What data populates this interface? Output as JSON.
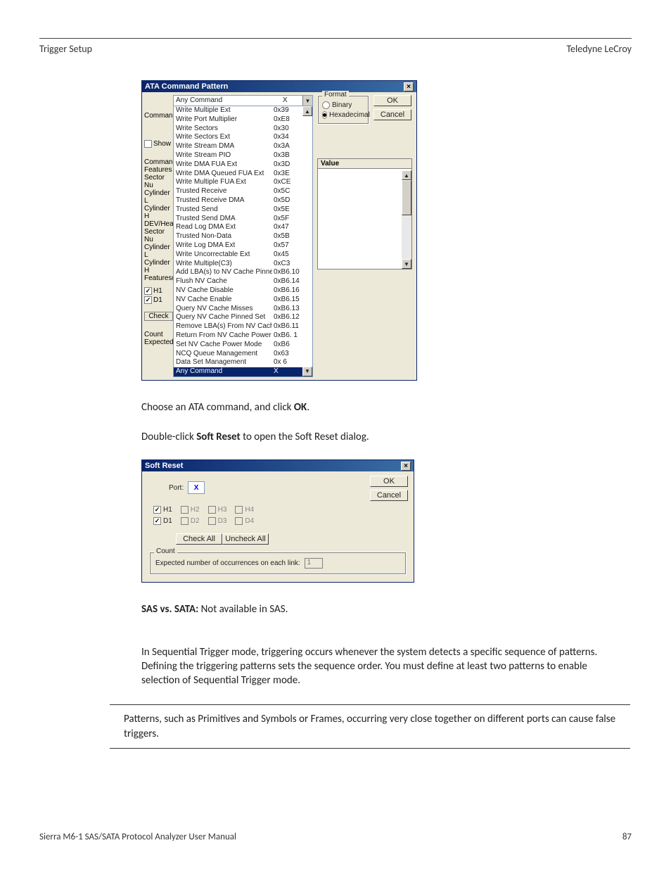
{
  "header": {
    "left": "Trigger Setup",
    "right": "Teledyne LeCroy"
  },
  "ata": {
    "title": "ATA Command Pattern",
    "command_label": "Command:",
    "combo": {
      "text": "Any Command",
      "code": "X"
    },
    "left_labels": [
      "Show",
      "Command",
      "Features",
      "Sector Nu",
      "Cylinder L",
      "Cylinder H",
      "DEV/Hea",
      "Sector Nu",
      "Cylinder L",
      "Cylinder H",
      "Features(",
      "H1",
      "D1",
      "Check",
      "Count",
      "Expected"
    ],
    "items": [
      {
        "n": "Write Multiple Ext",
        "c": "0x39"
      },
      {
        "n": "Write Port Multiplier",
        "c": "0xE8"
      },
      {
        "n": "Write Sectors",
        "c": "0x30"
      },
      {
        "n": "Write Sectors Ext",
        "c": "0x34"
      },
      {
        "n": "Write Stream DMA",
        "c": "0x3A"
      },
      {
        "n": "Write Stream PIO",
        "c": "0x3B"
      },
      {
        "n": "Write DMA FUA Ext",
        "c": "0x3D"
      },
      {
        "n": "Write DMA Queued FUA Ext",
        "c": "0x3E"
      },
      {
        "n": "Write Multiple FUA Ext",
        "c": "0xCE"
      },
      {
        "n": "Trusted Receive",
        "c": "0x5C"
      },
      {
        "n": "Trusted Receive DMA",
        "c": "0x5D"
      },
      {
        "n": "Trusted Send",
        "c": "0x5E"
      },
      {
        "n": "Trusted Send DMA",
        "c": "0x5F"
      },
      {
        "n": "Read Log DMA Ext",
        "c": "0x47"
      },
      {
        "n": "Trusted Non-Data",
        "c": "0x5B"
      },
      {
        "n": "Write Log DMA Ext",
        "c": "0x57"
      },
      {
        "n": "Write Uncorrectable Ext",
        "c": "0x45"
      },
      {
        "n": "Write Multiple(C3)",
        "c": "0xC3"
      },
      {
        "n": "Add LBA(s) to NV Cache Pinned Set",
        "c": "0xB6.10"
      },
      {
        "n": "Flush NV Cache",
        "c": "0xB6.14"
      },
      {
        "n": "NV Cache Disable",
        "c": "0xB6.16"
      },
      {
        "n": "NV Cache Enable",
        "c": "0xB6.15"
      },
      {
        "n": "Query NV Cache Misses",
        "c": "0xB6.13"
      },
      {
        "n": "Query NV Cache Pinned Set",
        "c": "0xB6.12"
      },
      {
        "n": "Remove LBA(s) From NV Cache Pinned S",
        "c": "0xB6.11"
      },
      {
        "n": "Return From NV Cache Power Mode",
        "c": "0xB6. 1"
      },
      {
        "n": "Set NV Cache Power Mode",
        "c": "0xB6"
      },
      {
        "n": "NCQ Queue Management",
        "c": "0x63"
      },
      {
        "n": "Data Set Management",
        "c": "0x 6"
      }
    ],
    "selected": {
      "n": "Any Command",
      "c": "X"
    },
    "format": {
      "legend": "Format",
      "binary": "Binary",
      "hex": "Hexadecimal"
    },
    "ok": "OK",
    "cancel": "Cancel",
    "value_header": "Value",
    "show_label": "Show"
  },
  "text1_pre": "Choose an ATA command, and click ",
  "text1_bold": "OK",
  "text1_post": ".",
  "text2_pre": "Double-click ",
  "text2_bold": "Soft Reset",
  "text2_post": " to open the Soft Reset dialog.",
  "sr": {
    "title": "Soft Reset",
    "port_label": "Port:",
    "port_value": "X",
    "ok": "OK",
    "cancel": "Cancel",
    "rows": [
      [
        {
          "l": "H1",
          "on": true,
          "en": true
        },
        {
          "l": "H2",
          "on": false,
          "en": false
        },
        {
          "l": "H3",
          "on": false,
          "en": false
        },
        {
          "l": "H4",
          "on": false,
          "en": false
        }
      ],
      [
        {
          "l": "D1",
          "on": true,
          "en": true
        },
        {
          "l": "D2",
          "on": false,
          "en": false
        },
        {
          "l": "D3",
          "on": false,
          "en": false
        },
        {
          "l": "D4",
          "on": false,
          "en": false
        }
      ]
    ],
    "check_all": "Check All",
    "uncheck_all": "Uncheck All",
    "count_legend": "Count",
    "count_label": "Expected number of occurrences on each link:",
    "count_value": "1"
  },
  "sas_bold": "SAS vs. SATA:",
  "sas_rest": " Not available in SAS.",
  "seq_text": "In Sequential Trigger mode, triggering occurs whenever the system detects a specific sequence of patterns. Defining the triggering patterns sets the sequence order. You must define at least two patterns to enable selection of Sequential Trigger mode.",
  "hr_text": "Patterns, such as Primitives and Symbols or Frames, occurring very close together on different ports can cause false triggers.",
  "footer": {
    "left": "Sierra M6-1 SAS/SATA Protocol Analyzer User Manual",
    "right": "87"
  }
}
